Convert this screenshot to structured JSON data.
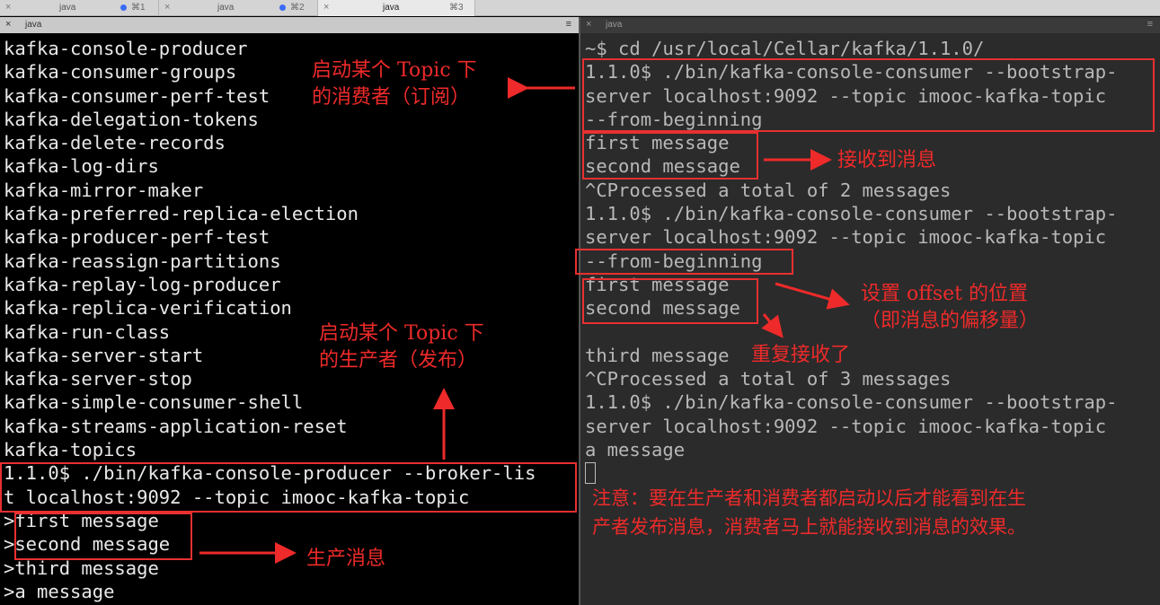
{
  "tabs": [
    {
      "close": "×",
      "name": "java",
      "shortcut": "⌘1",
      "dot": true,
      "active": false
    },
    {
      "close": "×",
      "name": "java",
      "shortcut": "⌘2",
      "dot": true,
      "active": false
    },
    {
      "close": "×",
      "name": "java",
      "shortcut": "⌘3",
      "dot": false,
      "active": true
    }
  ],
  "left_pane": {
    "close": "×",
    "title": "java",
    "menu": "≡",
    "lines": [
      "kafka-console-producer",
      "kafka-consumer-groups",
      "kafka-consumer-perf-test",
      "kafka-delegation-tokens",
      "kafka-delete-records",
      "kafka-log-dirs",
      "kafka-mirror-maker",
      "kafka-preferred-replica-election",
      "kafka-producer-perf-test",
      "kafka-reassign-partitions",
      "kafka-replay-log-producer",
      "kafka-replica-verification",
      "kafka-run-class",
      "kafka-server-start",
      "kafka-server-stop",
      "kafka-simple-consumer-shell",
      "kafka-streams-application-reset",
      "kafka-topics",
      "1.1.0$ ./bin/kafka-console-producer --broker-lis",
      "t localhost:9092 --topic imooc-kafka-topic",
      ">first message",
      ">second message",
      ">third message",
      ">a message"
    ]
  },
  "right_pane": {
    "close": "×",
    "title": "java",
    "menu": "≡",
    "lines": [
      "~$ cd /usr/local/Cellar/kafka/1.1.0/",
      "1.1.0$ ./bin/kafka-console-consumer --bootstrap-",
      "server localhost:9092 --topic imooc-kafka-topic",
      "--from-beginning",
      "first message",
      "second message",
      "^CProcessed a total of 2 messages",
      "1.1.0$ ./bin/kafka-console-consumer --bootstrap-",
      "server localhost:9092 --topic imooc-kafka-topic",
      "--from-beginning",
      "first message",
      "second message",
      "",
      "third message",
      "^CProcessed a total of 3 messages",
      "1.1.0$ ./bin/kafka-console-consumer --bootstrap-",
      "server localhost:9092 --topic imooc-kafka-topic",
      "a message"
    ]
  },
  "annotations": {
    "consumer_start": "启动某个 Topic 下\n的消费者（订阅）",
    "producer_start": "启动某个 Topic 下\n的生产者（发布）",
    "received": "接收到消息",
    "offset": "设置 offset 的位置\n（即消息的偏移量）",
    "repeat": "重复接收了",
    "produce": "生产消息",
    "note": "注意：要在生产者和消费者都启动以后才能看到在生\n产者发布消息，消费者马上就能接收到消息的效果。"
  },
  "colors": {
    "annotation": "#ee2a2a",
    "left_bg": "#000000",
    "right_bg": "#2b2b2b"
  }
}
